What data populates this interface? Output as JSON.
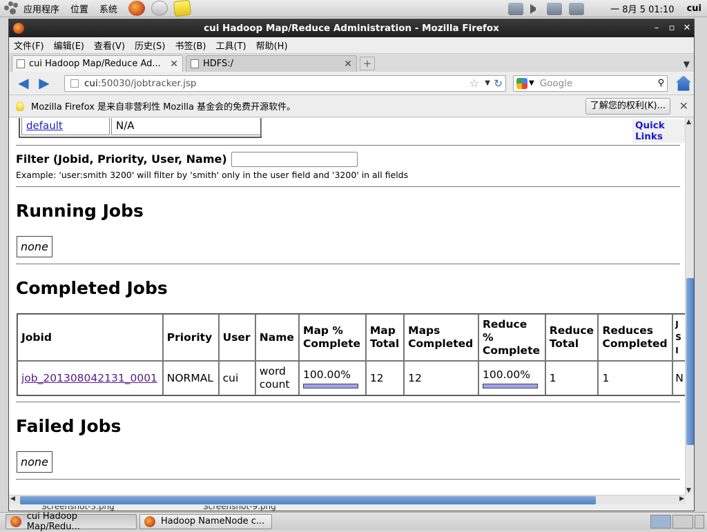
{
  "panel": {
    "menus": [
      "应用程序",
      "位置",
      "系统"
    ],
    "clock": "一 8月  5 01:10",
    "user": "cui"
  },
  "window": {
    "title": "cui Hadoop Map/Reduce Administration - Mozilla Firefox"
  },
  "menubar": [
    "文件(F)",
    "编辑(E)",
    "查看(V)",
    "历史(S)",
    "书签(B)",
    "工具(T)",
    "帮助(H)"
  ],
  "tabs": [
    {
      "label": "cui Hadoop Map/Reduce Ad...",
      "active": true
    },
    {
      "label": "HDFS:/",
      "active": false
    }
  ],
  "navbar": {
    "url_host": "cui",
    "url_rest": ":50030/jobtracker.jsp",
    "search_placeholder": "Google"
  },
  "notification": {
    "text": "Mozilla Firefox 是来自非营利性 Mozilla 基金会的免费开源软件。",
    "button": "了解您的权利(K)..."
  },
  "page": {
    "queue_row": {
      "name": "default",
      "info": "N/A"
    },
    "quick_links": "Quick Links",
    "filter_label": "Filter (Jobid, Priority, User, Name)",
    "filter_example": "Example: 'user:smith 3200' will filter by 'smith' only in the user field and '3200' in all fields",
    "running_heading": "Running Jobs",
    "running_none": "none",
    "completed_heading": "Completed Jobs",
    "completed_columns": [
      "Jobid",
      "Priority",
      "User",
      "Name",
      "Map % Complete",
      "Map Total",
      "Maps Completed",
      "Reduce % Complete",
      "Reduce Total",
      "Reduces Completed",
      "J S I"
    ],
    "completed_rows": [
      {
        "jobid": "job_201308042131_0001",
        "priority": "NORMAL",
        "user": "cui",
        "name": "word count",
        "map_pct": "100.00%",
        "map_progress": 1.0,
        "map_total": "12",
        "maps_completed": "12",
        "reduce_pct": "100.00%",
        "reduce_progress": 1.0,
        "reduce_total": "1",
        "reduces_completed": "1",
        "extra": "N"
      }
    ],
    "failed_heading": "Failed Jobs",
    "failed_none": "none"
  },
  "desktop_files": [
    "Screenshot-3.png",
    "Screenshot-9.png"
  ],
  "taskbar": [
    {
      "label": "cui Hadoop Map/Redu...",
      "active": true
    },
    {
      "label": "Hadoop NameNode c...",
      "active": false
    }
  ]
}
